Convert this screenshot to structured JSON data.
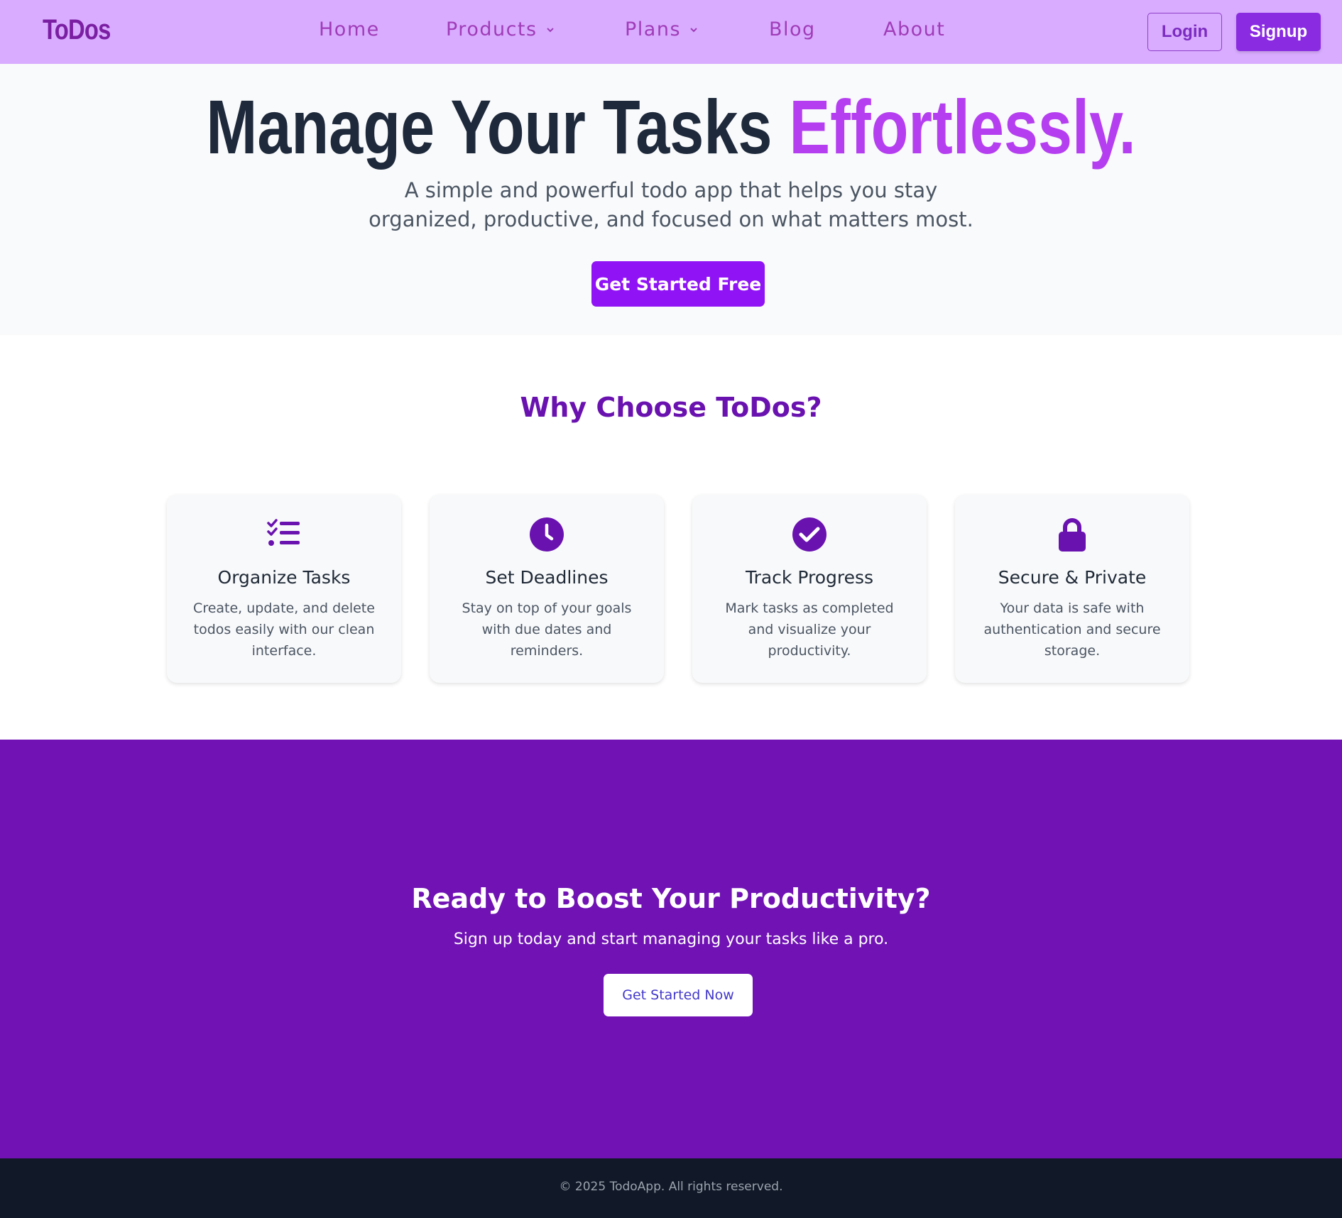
{
  "brand": {
    "logo": "ToDos"
  },
  "nav": {
    "links": [
      {
        "label": "Home"
      },
      {
        "label": "Products"
      },
      {
        "label": "Plans"
      },
      {
        "label": "Blog"
      },
      {
        "label": "About"
      }
    ],
    "login_label": "Login",
    "signup_label": "Signup"
  },
  "hero": {
    "title_main": "Manage Your Tasks",
    "title_accent": "Effortlessly.",
    "subtitle": "A simple and powerful todo app that helps you stay organized, productive, and focused on what matters most.",
    "cta_label": "Get Started Free"
  },
  "features": {
    "heading": "Why Choose ToDos?",
    "cards": [
      {
        "icon": "list-check-icon",
        "title": "Organize Tasks",
        "desc": "Create, update, and delete todos easily with our clean interface."
      },
      {
        "icon": "clock-icon",
        "title": "Set Deadlines",
        "desc": "Stay on top of your goals with due dates and reminders."
      },
      {
        "icon": "check-circle-icon",
        "title": "Track Progress",
        "desc": "Mark tasks as completed and visualize your productivity."
      },
      {
        "icon": "lock-icon",
        "title": "Secure & Private",
        "desc": "Your data is safe with authentication and secure storage."
      }
    ]
  },
  "cta": {
    "heading": "Ready to Boost Your Productivity?",
    "subtitle": "Sign up today and start managing your tasks like a pro.",
    "button_label": "Get Started Now"
  },
  "footer": {
    "text": "© 2025 TodoApp. All rights reserved."
  },
  "colors": {
    "navbar_bg": "#d9acff",
    "brand_purple": "#7b1fa2",
    "accent": "#b53ff0",
    "primary_button": "#9013f5",
    "cta_bg": "#7012b4",
    "footer_bg": "#111827"
  }
}
